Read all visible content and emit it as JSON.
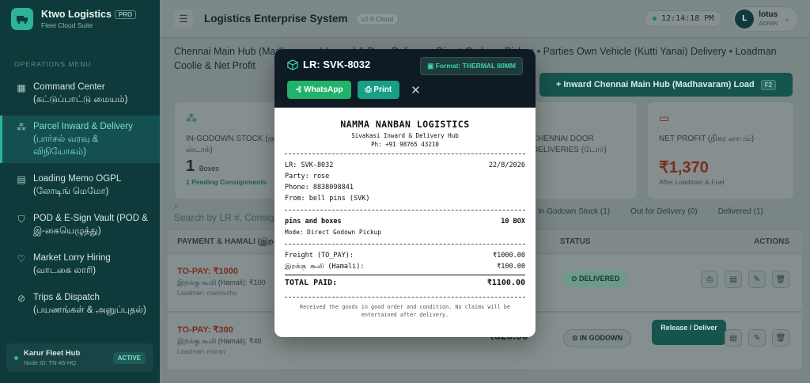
{
  "sidebar": {
    "brand_title": "Ktwo Logistics",
    "brand_badge": "PRO",
    "brand_sub": "Fleet Cloud Suite",
    "section": "OPERATIONS MENU",
    "items": [
      {
        "label": "Command Center (கட்டுப்பாட்டு மையம்)",
        "icon": "grid-icon"
      },
      {
        "label": "Parcel Inward & Delivery (பார்சல் வரவு & விநியோகம்)",
        "icon": "boxes-icon"
      },
      {
        "label": "Loading Memo OGPL (லோடிங் மெமோ)",
        "icon": "document-icon"
      },
      {
        "label": "POD & E-Sign Vault (POD & இ-கையெழுத்து)",
        "icon": "shield-icon"
      },
      {
        "label": "Market Lorry Hiring (வாடகை லாரி)",
        "icon": "handshake-icon"
      },
      {
        "label": "Trips & Dispatch (பயணங்கள் & அனுப்புதல்)",
        "icon": "compass-icon"
      }
    ],
    "hub_name": "Karur Fleet Hub",
    "hub_node": "Node ID: TN-45-HQ",
    "hub_status": "ACTIVE"
  },
  "header": {
    "title": "Logistics Enterprise System",
    "version": "v2.6 Cloud",
    "clock": "12:14:18 PM",
    "user_initial": "L",
    "user_name": "lotus",
    "user_role": "ADMIN"
  },
  "main": {
    "subtitle": "Chennai Main Hub (Madhavaram) Inward & Door Delivery • Direct Godown Pickup • Parties Own Vehicle (Kutti Yanai) Delivery • Loadman Coolie & Net Profit",
    "inward_button": "+ Inward Chennai Main Hub (Madhavaram) Load",
    "inward_shortcut": "F2",
    "cards": [
      {
        "label": "IN-GODOWN STOCK (குடோன் ஸ்டாக்)",
        "value": "1",
        "unit": "Boxes",
        "sub": "1 Pending Consignments"
      },
      {
        "label": "CHENNAI DOOR DELIVERIES (டோர்)",
        "value": "",
        "unit": "",
        "sub": ""
      },
      {
        "label": "NET PROFIT (நிகர லாபம்)",
        "value": "₹1,370",
        "unit": "",
        "sub": "After Loadman & Fuel"
      }
    ],
    "search_placeholder": "Search by LR #, Consignee...",
    "tabs": [
      "In Godown Stock (1)",
      "Out for Delivery (0)",
      "Delivered (1)"
    ],
    "columns": {
      "payment": "PAYMENT & HAMALI (இறக்கு கூலி)",
      "status": "STATUS",
      "actions": "ACTIONS"
    },
    "rows": [
      {
        "topay": "TO-PAY: ₹1000",
        "hamali": "இறக்கு கூலி (Hamali): ₹100",
        "loadman": "Loadman: marimuthu",
        "status": "DELIVERED",
        "amount": ""
      },
      {
        "topay": "TO-PAY: ₹300",
        "hamali": "இறக்கு கூலி (Hamali): ₹40",
        "loadman": "Loadman: maran",
        "status": "IN GODOWN",
        "amount": "₹320.00",
        "release": "Release / Deliver"
      }
    ]
  },
  "modal": {
    "title": "LR: SVK-8032",
    "format": "Format: THERMAL 80MM",
    "whatsapp": "WhatsApp",
    "print": "Print",
    "receipt": {
      "company": "NAMMA NANBAN LOGISTICS",
      "hub": "Sivakasi Inward & Delivery Hub",
      "phone": "Ph: +91 98765 43210",
      "lr": "LR: SVK-8032",
      "date": "22/8/2026",
      "party": "Party: rose",
      "party_phone": "Phone: 8838098841",
      "from": "From: bell pins (SVK)",
      "item": "pins and boxes",
      "qty": "10 BOX",
      "mode": "Mode: Direct Godown Pickup",
      "freight_label": "Freight (TO_PAY):",
      "freight_value": "₹1000.00",
      "hamali_label": "இறக்கு கூலி (Hamali):",
      "hamali_value": "₹100.00",
      "total_label": "TOTAL PAID:",
      "total_value": "₹1100.00",
      "note": "Received the goods in good order and condition. No claims will be entertained after delivery."
    }
  }
}
